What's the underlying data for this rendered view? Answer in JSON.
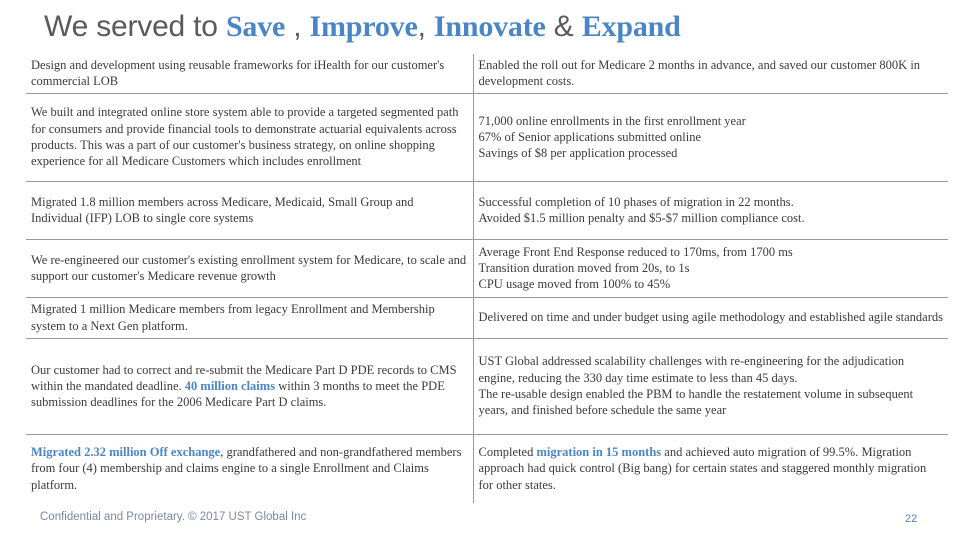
{
  "slide": {
    "title": {
      "prefix": "We served to ",
      "kw1": "Save",
      "sep1": " , ",
      "kw2": "Improve",
      "sep2": ", ",
      "kw3": "Innovate",
      "sep3": " & ",
      "kw4": "Expand"
    },
    "rows": [
      {
        "left": [
          "Design and development using reusable frameworks for iHealth for our customer's commercial LOB"
        ],
        "right": [
          "Enabled the roll out for Medicare 2 months in advance, and saved our customer 800K in development costs."
        ]
      },
      {
        "left": [
          "We built and integrated online store system able to provide a targeted segmented path for consumers and provide financial tools to demonstrate actuarial equivalents across products. This was a part of our customer's business strategy, on online shopping experience for all Medicare Customers which includes enrollment"
        ],
        "right": [
          "71,000 online enrollments in the first enrollment year",
          "67% of Senior applications submitted online",
          "Savings of $8 per application processed"
        ]
      },
      {
        "left": [
          "Migrated 1.8 million members across Medicare, Medicaid, Small Group and Individual (IFP) LOB to single core systems"
        ],
        "right": [
          "Successful completion of 10 phases of migration in 22 months.",
          "Avoided $1.5 million penalty and $5-$7 million compliance cost."
        ]
      },
      {
        "left": [
          "We re-engineered our customer's existing enrollment system for Medicare, to scale and support our customer's Medicare revenue growth"
        ],
        "right": [
          "Average Front End Response reduced to 170ms, from 1700 ms",
          "Transition duration moved from 20s, to 1s",
          "CPU usage moved from 100% to 45%"
        ]
      },
      {
        "left": [
          "Migrated 1 million Medicare members from legacy Enrollment and Membership system to a Next Gen platform."
        ],
        "right": [
          "Delivered on time and under budget using agile methodology and established agile standards"
        ]
      },
      {
        "left_a": "Our customer had to correct and re-submit the Medicare Part D PDE records to CMS within the mandated deadline. ",
        "left_hl": "40 million claims",
        "left_b": " within 3 months to meet the PDE submission deadlines for the 2006 Medicare Part D claims.",
        "right": [
          "UST Global addressed scalability challenges with re-engineering for the adjudication engine, reducing the 330 day time estimate to less than 45 days.",
          "The re-usable design enabled the PBM to handle the restatement volume in subsequent years, and finished before schedule the same year"
        ]
      },
      {
        "left_hl": "Migrated 2.32 million Off exchange",
        "left_b": ", grandfathered and non-grandfathered members from four (4) membership and claims engine to a single Enrollment and Claims platform.",
        "right_a": "Completed ",
        "right_hl": "migration in 15 months",
        "right_b": " and achieved auto migration of 99.5%. Migration approach had quick control (Big bang) for certain states and staggered monthly migration for other states."
      }
    ],
    "footer": "Confidential and Proprietary. © 2017 UST Global Inc",
    "page_number": "22",
    "colors": {
      "accent": "#4a86c5",
      "text": "#3b3b3b",
      "title": "#5a5a5a",
      "rule": "#9a9a9a"
    }
  }
}
